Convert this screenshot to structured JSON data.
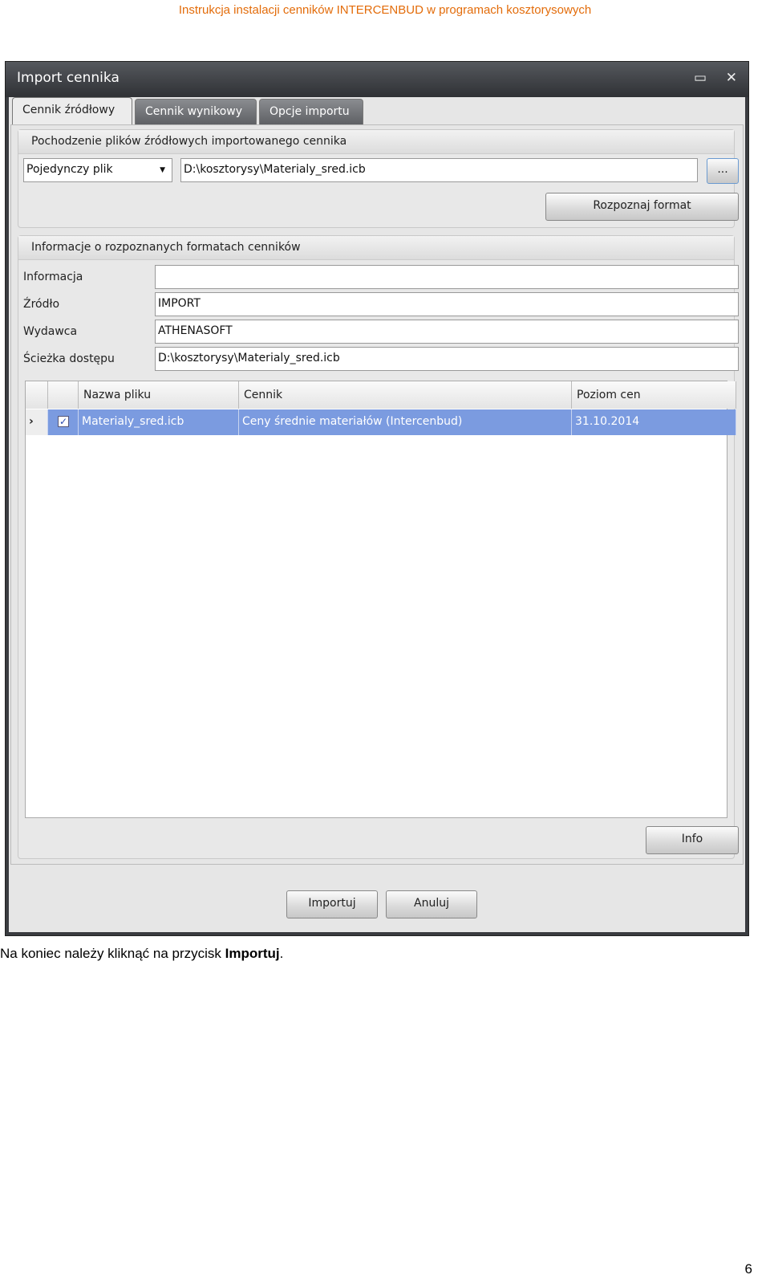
{
  "header": "Instrukcja instalacji cenników INTERCENBUD w programach kosztorysowych",
  "window": {
    "title": "Import cennika",
    "maximize_icon": "maximize-icon",
    "close_icon": "close-icon"
  },
  "tabs": [
    "Cennik źródłowy",
    "Cennik wynikowy",
    "Opcje importu"
  ],
  "source": {
    "title": "Pochodzenie plików źródłowych importowanego cennika",
    "mode": "Pojedynczy plik",
    "path": "D:\\kosztorysy\\Materialy_sred.icb",
    "browse": "...",
    "recognize": "Rozpoznaj format"
  },
  "info": {
    "title": "Informacje o rozpoznanych formatach cenników",
    "fields": [
      {
        "label": "Informacja",
        "value": ""
      },
      {
        "label": "Źródło",
        "value": "IMPORT"
      },
      {
        "label": "Wydawca",
        "value": "ATHENASOFT"
      },
      {
        "label": "Ścieżka dostępu",
        "value": "D:\\kosztorysy\\Materialy_sred.icb"
      }
    ]
  },
  "grid": {
    "columns": [
      "Nazwa pliku",
      "Cennik",
      "Poziom cen"
    ],
    "rows": [
      {
        "checked": true,
        "file": "Materialy_sred.icb",
        "cennik": "Ceny średnie materiałów (Intercenbud)",
        "poziom": "31.10.2014"
      }
    ],
    "selection_color": "#7b9be0"
  },
  "buttons": {
    "info": "Info",
    "import": "Importuj",
    "cancel": "Anuluj"
  },
  "caption": {
    "text": "Na koniec należy kliknąć na przycisk ",
    "bold": "Importuj",
    "end": "."
  },
  "page_number": "6"
}
